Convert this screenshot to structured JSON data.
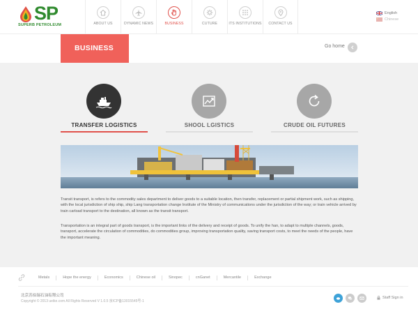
{
  "brand": {
    "logo_text": "SP",
    "subtitle": "SUPERB PETROLEUM",
    "green": "#2f8a2e"
  },
  "nav": [
    {
      "label": "ABOUT US",
      "icon": "home-icon"
    },
    {
      "label": "DYNAMIC NEWS",
      "icon": "plane-icon"
    },
    {
      "label": "BUSINESS",
      "icon": "hand-icon",
      "active": true
    },
    {
      "label": "CUTURE",
      "icon": "gear-icon"
    },
    {
      "label": "ITS INSTITUTIONS",
      "icon": "grid-icon"
    },
    {
      "label": "CONTACT US",
      "icon": "location-icon"
    }
  ],
  "lang": {
    "english": "English",
    "chinese": "Chinese"
  },
  "section": {
    "title": "BUSINESS",
    "go_home": "Go home",
    "accent": "#f0615a"
  },
  "services": [
    {
      "label": "TRANSFER LOGISTICS",
      "icon": "ship-icon",
      "active": true
    },
    {
      "label": "SHOOL LGISTICS",
      "icon": "chart-trend-icon"
    },
    {
      "label": "CRUDE OIL FUTURES",
      "icon": "refresh-icon"
    }
  ],
  "content": {
    "para1": "Transit transport, is refers to the commodity sales department to deliver goods to a suitable location, then transfer, replacement or partial shipment work, such as shipping, with the local jurisdiction of ship ship, ship Lang transportation change Institute of the Ministry of communications under the jurisdiction of the way; or train vehicle arrived by train carload transport to the destination, all known as the transit transport.",
    "para2": "Transportation is an integral part of goods transport, is the important links of the delivery and receipt of goods. To unify the han, to adapt to multiple channels, goods, transport, accelerate the circulation of commodities, do commodities group, improving transportation quality, saving transport costs, to meet the needs of the people, have the important meaning."
  },
  "footer": {
    "links": [
      "Metals",
      "Hope the energy",
      "Economics",
      "Chinese oil",
      "Sinopec",
      "cnGanet",
      "Mercantile",
      "Exchange"
    ],
    "copyright_cn": "北京苏伯瑞石油有限公司",
    "copyright": "Copyright © 2013 ueike.com All Rights Reserved V 1.0.5 京ICP备13015545号-1",
    "staff_sign_in": "Staff Sign in"
  }
}
